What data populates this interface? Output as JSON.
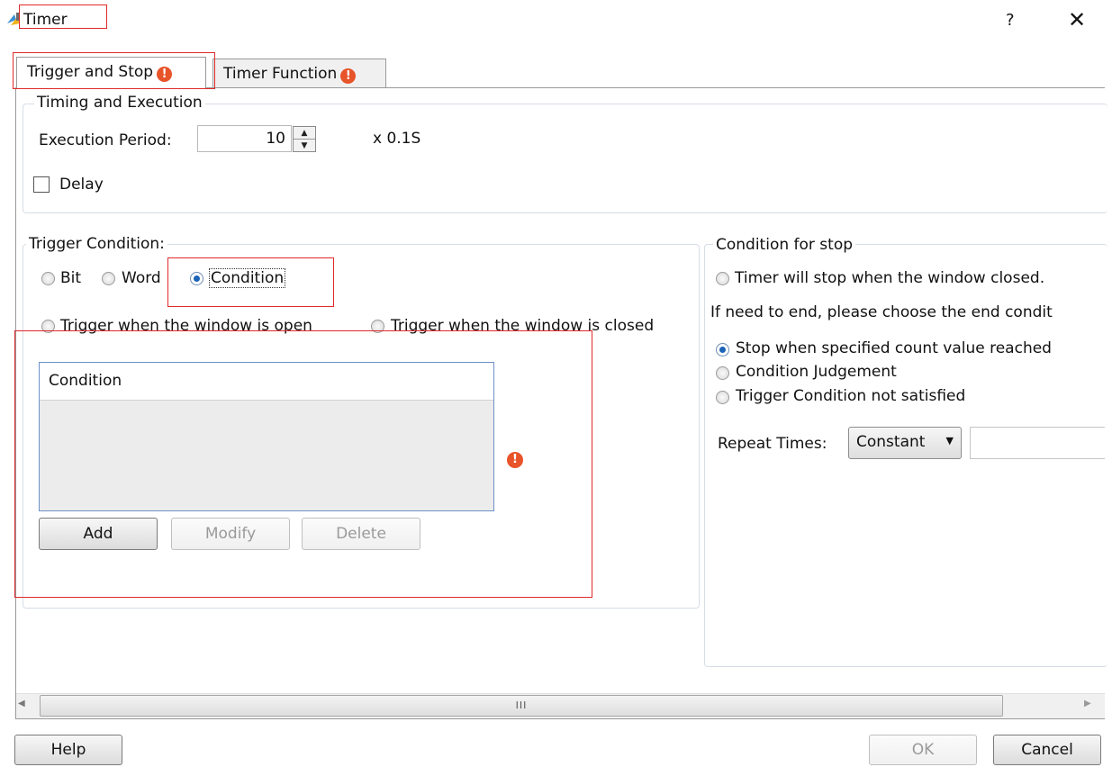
{
  "window": {
    "title": "Timer",
    "help_label": "?",
    "close_label": "✕"
  },
  "tabs": [
    {
      "label": "Trigger and Stop",
      "warning": "!"
    },
    {
      "label": "Timer Function",
      "warning": "!"
    }
  ],
  "timing": {
    "legend": "Timing and Execution",
    "period_label": "Execution Period:",
    "period_value": "10",
    "period_unit": "x 0.1S",
    "delay_label": "Delay"
  },
  "trigger": {
    "legend": "Trigger Condition:",
    "type_options": [
      "Bit",
      "Word",
      "Condition"
    ],
    "selected_type": "Condition",
    "open_label": "Trigger when the window is open",
    "closed_label": "Trigger when the window is closed",
    "list_header": "Condition",
    "warning": "!",
    "add_label": "Add",
    "modify_label": "Modify",
    "delete_label": "Delete"
  },
  "stop": {
    "legend": "Condition for stop",
    "window_closed_label": "Timer will stop when the window closed.",
    "hint": "If need to end, please choose the end condit",
    "options": [
      "Stop when specified count value reached",
      "Condition Judgement",
      "Trigger Condition not satisfied"
    ],
    "selected_option": "Stop when specified count value reached",
    "repeat_label": "Repeat Times:",
    "repeat_mode": "Constant",
    "repeat_value": ""
  },
  "scrollbar": {
    "left_arrow": "◀",
    "right_arrow": "▶",
    "grip": "III"
  },
  "footer": {
    "help_label": "Help",
    "ok_label": "OK",
    "cancel_label": "Cancel"
  },
  "colors": {
    "highlight": "#e02a2a",
    "warning": "#e8542a",
    "selected_radio": "#1c63b7"
  }
}
